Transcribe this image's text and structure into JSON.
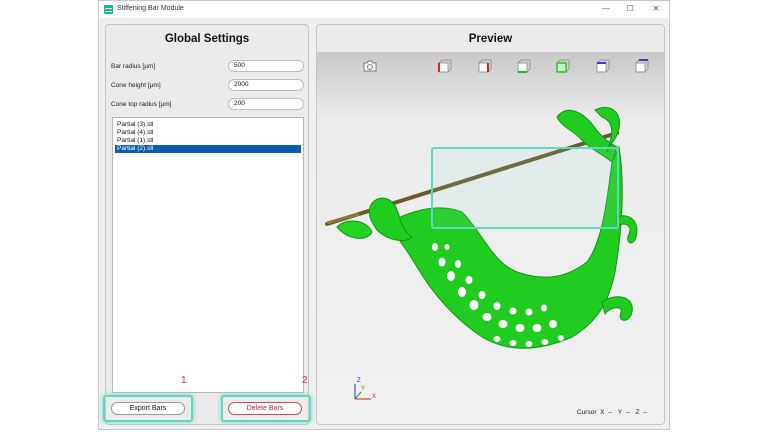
{
  "window": {
    "title": "Stiffening Bar Module",
    "controls": [
      "—",
      "☐",
      "✕"
    ]
  },
  "left_panel": {
    "title": "Global Settings",
    "fields": [
      {
        "label": "Bar radius [µm]",
        "value": "500"
      },
      {
        "label": "Cone height [µm]",
        "value": "2000"
      },
      {
        "label": "Cone top radius [µm]",
        "value": "200"
      }
    ],
    "files": [
      "Partial (3).stl",
      "Partial (4).stl",
      "Partial (1).stl",
      "Partial (2).stl"
    ],
    "selected_file": "Partial (2).stl",
    "export_button": "Export Bars",
    "delete_button": "Delete Bars",
    "markers": [
      "1",
      "2"
    ]
  },
  "preview": {
    "title": "Preview",
    "toolbar_icons": [
      "camera-icon",
      "cube-red-icon",
      "cube-red-alt-icon",
      "cube-green-icon",
      "cube-green-alt-icon",
      "cube-blue-icon",
      "cube-blue-alt-icon"
    ],
    "axis_labels": [
      "Z",
      "X",
      "Y"
    ],
    "cursor": {
      "label": "Cursor",
      "x_label": "X",
      "x_value": "--",
      "y_label": "Y",
      "y_value": "--",
      "z_label": "Z",
      "z_value": "--"
    }
  },
  "colors": {
    "accent_highlight": "#61d6c0",
    "model": "#1fcc1f",
    "bar": "#6b5a2a",
    "selection": "#0b5cad",
    "marker": "#d23c3c"
  }
}
